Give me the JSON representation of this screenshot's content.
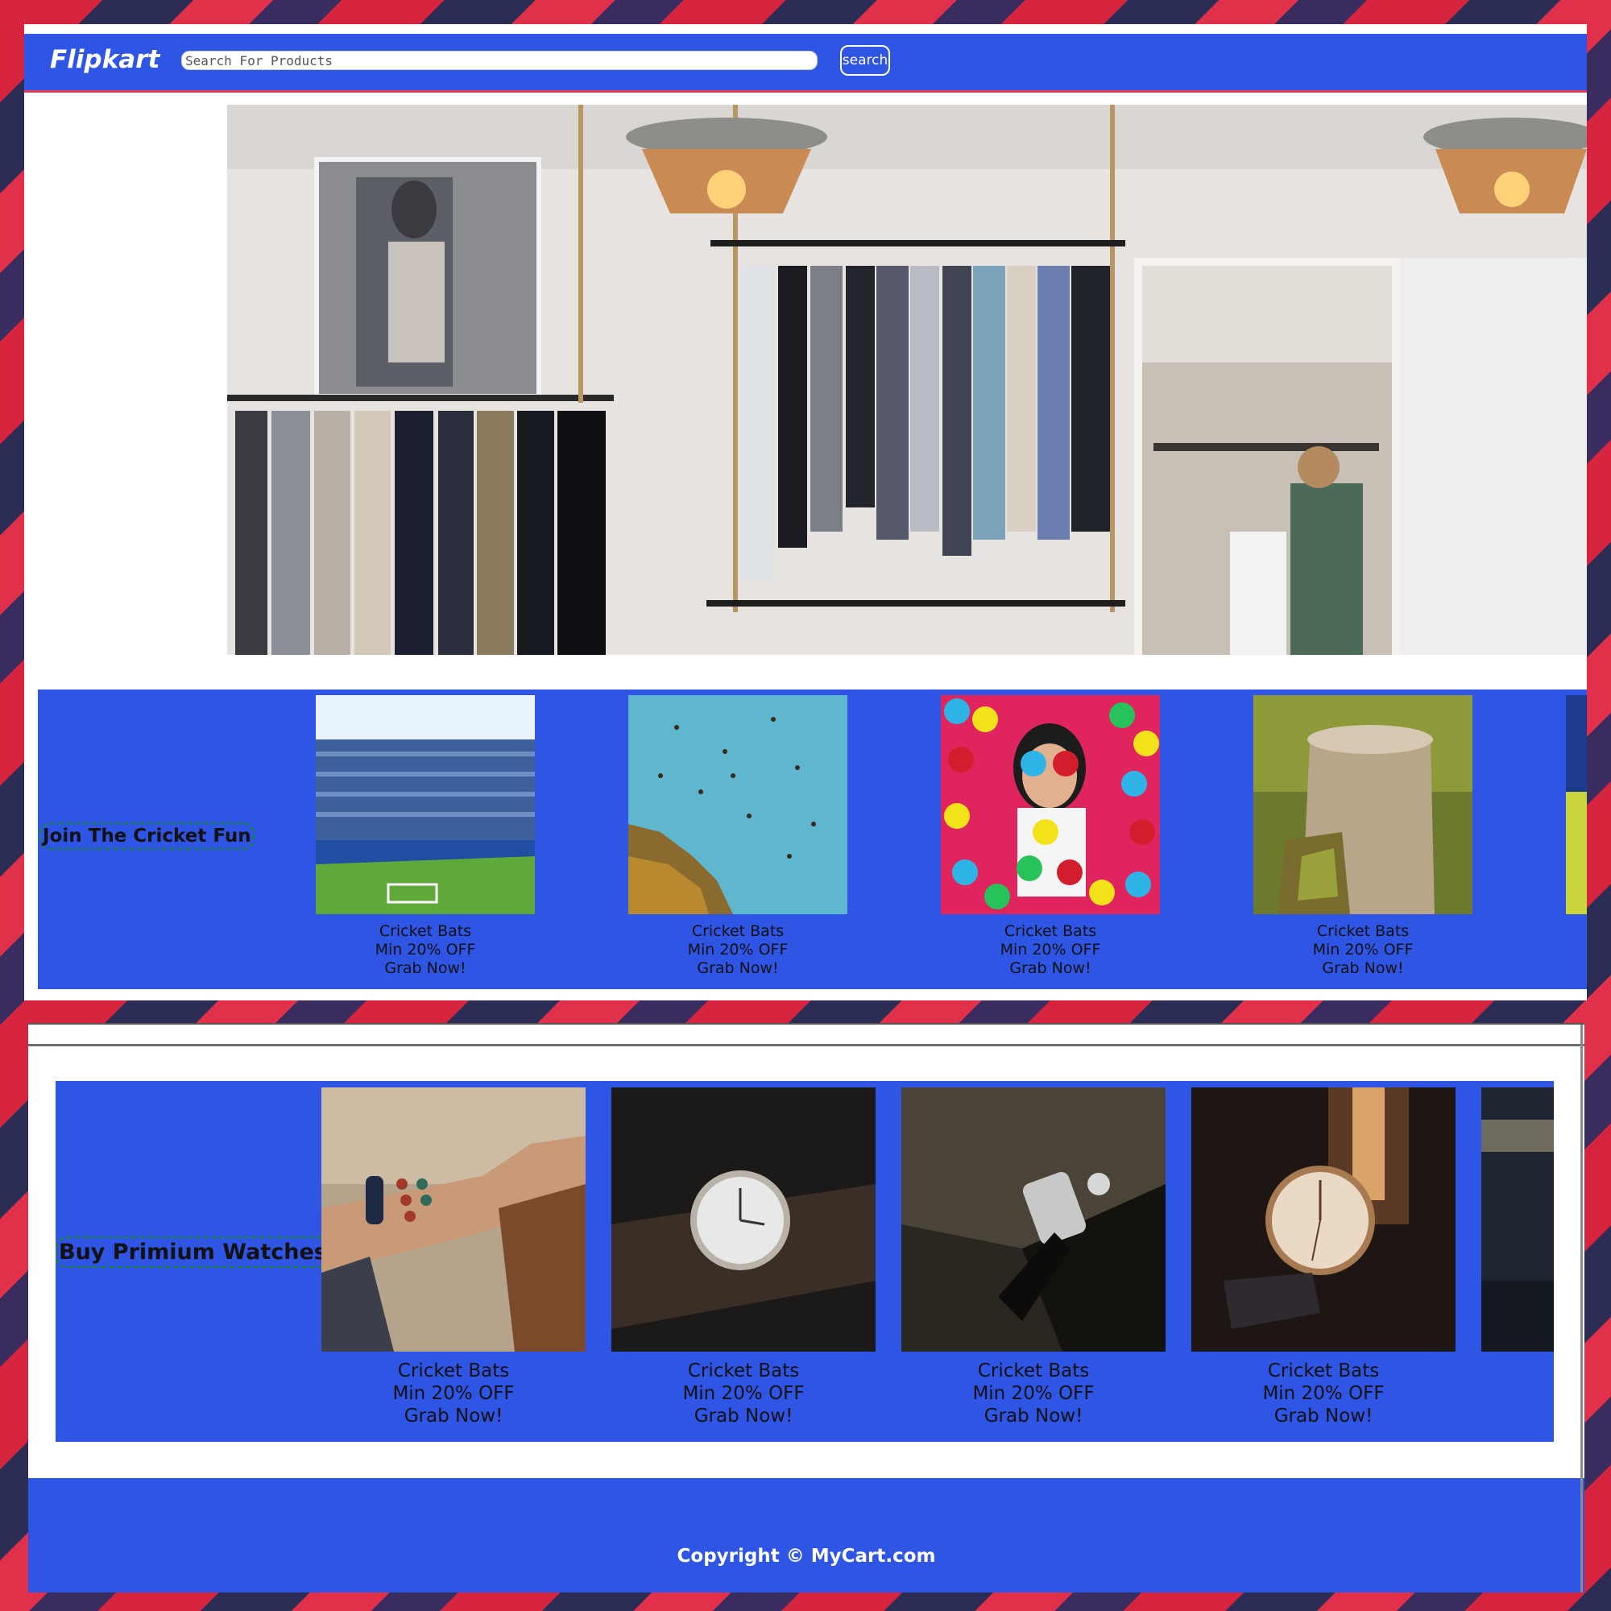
{
  "header": {
    "brand": "Flipkart",
    "search_placeholder": "Search For Products",
    "search_button": "search"
  },
  "section1": {
    "title": "Join The Cricket Fun",
    "cards": [
      {
        "image": "stadium-photo",
        "line1": "Cricket Bats",
        "line2": "Min 20% OFF",
        "line3": "Grab Now!"
      },
      {
        "image": "birds-sky-photo",
        "line1": "Cricket Bats",
        "line2": "Min 20% OFF",
        "line3": "Grab Now!"
      },
      {
        "image": "ball-pit-photo",
        "line1": "Cricket Bats",
        "line2": "Min 20% OFF",
        "line3": "Grab Now!"
      },
      {
        "image": "tree-stump-photo",
        "line1": "Cricket Bats",
        "line2": "Min 20% OFF",
        "line3": "Grab Now!"
      }
    ]
  },
  "section2": {
    "title": "Buy Primium Watches",
    "cards": [
      {
        "image": "wrist-bracelets-photo",
        "line1": "Cricket Bats",
        "line2": "Min 20% OFF",
        "line3": "Grab Now!"
      },
      {
        "image": "wristwatch-dark-photo",
        "line1": "Cricket Bats",
        "line2": "Min 20% OFF",
        "line3": "Grab Now!"
      },
      {
        "image": "metal-watch-photo",
        "line1": "Cricket Bats",
        "line2": "Min 20% OFF",
        "line3": "Grab Now!"
      },
      {
        "image": "gold-watch-photo",
        "line1": "Cricket Bats",
        "line2": "Min 20% OFF",
        "line3": "Grab Now!"
      }
    ]
  },
  "footer": {
    "copyright": "Copyright © MyCart.com"
  },
  "colors": {
    "primary_blue": "#2f55e4",
    "accent_red": "#e43a52",
    "title_outline": "#1b8a2e"
  }
}
